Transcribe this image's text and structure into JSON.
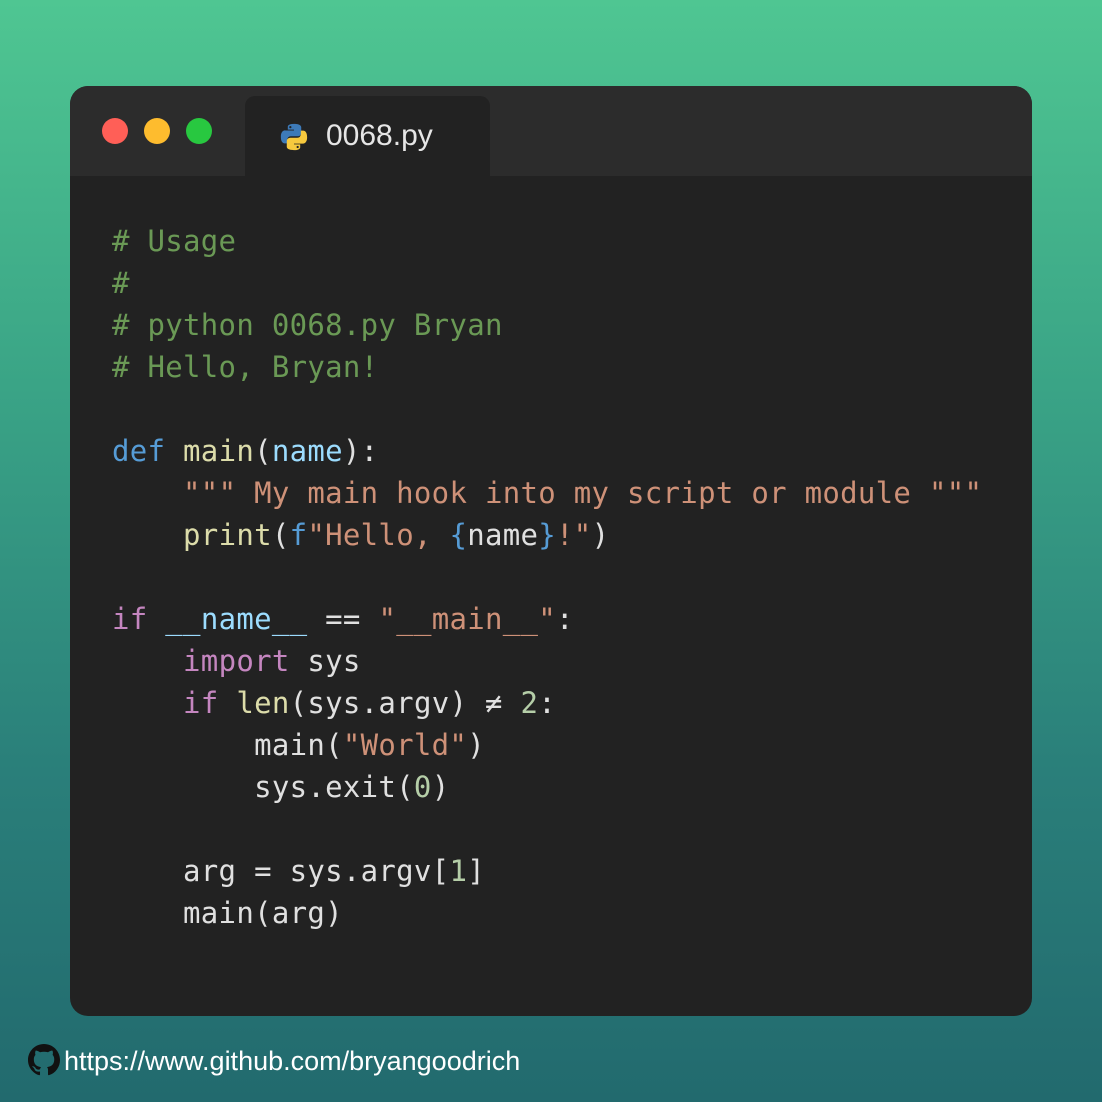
{
  "window": {
    "dots": [
      "close",
      "minimize",
      "maximize"
    ],
    "colors": {
      "close": "#ff5f57",
      "minimize": "#febc2e",
      "maximize": "#28c840"
    }
  },
  "tab": {
    "icon": "python-icon",
    "filename": "0068.py"
  },
  "code": {
    "lines": [
      [
        {
          "t": "# Usage",
          "c": "comment"
        }
      ],
      [
        {
          "t": "#",
          "c": "comment"
        }
      ],
      [
        {
          "t": "# python 0068.py Bryan",
          "c": "comment"
        }
      ],
      [
        {
          "t": "# Hello, Bryan!",
          "c": "comment"
        }
      ],
      [],
      [
        {
          "t": "def",
          "c": "keyword"
        },
        {
          "t": " ",
          "c": "plain"
        },
        {
          "t": "main",
          "c": "func"
        },
        {
          "t": "(",
          "c": "plain"
        },
        {
          "t": "name",
          "c": "param"
        },
        {
          "t": "):",
          "c": "plain"
        }
      ],
      [
        {
          "t": "    ",
          "c": "plain"
        },
        {
          "t": "\"\"\" My main hook into my script or module \"\"\"",
          "c": "string"
        }
      ],
      [
        {
          "t": "    ",
          "c": "plain"
        },
        {
          "t": "print",
          "c": "func"
        },
        {
          "t": "(",
          "c": "plain"
        },
        {
          "t": "f",
          "c": "keyword"
        },
        {
          "t": "\"Hello, ",
          "c": "string"
        },
        {
          "t": "{",
          "c": "brace"
        },
        {
          "t": "name",
          "c": "plain"
        },
        {
          "t": "}",
          "c": "brace"
        },
        {
          "t": "!\"",
          "c": "string"
        },
        {
          "t": ")",
          "c": "plain"
        }
      ],
      [],
      [
        {
          "t": "if",
          "c": "control"
        },
        {
          "t": " ",
          "c": "plain"
        },
        {
          "t": "__name__",
          "c": "param"
        },
        {
          "t": " ",
          "c": "plain"
        },
        {
          "t": "==",
          "c": "plain"
        },
        {
          "t": " ",
          "c": "plain"
        },
        {
          "t": "\"__main__\"",
          "c": "string"
        },
        {
          "t": ":",
          "c": "plain"
        }
      ],
      [
        {
          "t": "    ",
          "c": "plain"
        },
        {
          "t": "import",
          "c": "control"
        },
        {
          "t": " sys",
          "c": "plain"
        }
      ],
      [
        {
          "t": "    ",
          "c": "plain"
        },
        {
          "t": "if",
          "c": "control"
        },
        {
          "t": " ",
          "c": "plain"
        },
        {
          "t": "len",
          "c": "func"
        },
        {
          "t": "(sys.argv) ",
          "c": "plain"
        },
        {
          "t": "≠",
          "c": "plain"
        },
        {
          "t": " ",
          "c": "plain"
        },
        {
          "t": "2",
          "c": "number"
        },
        {
          "t": ":",
          "c": "plain"
        }
      ],
      [
        {
          "t": "        main(",
          "c": "plain"
        },
        {
          "t": "\"World\"",
          "c": "string"
        },
        {
          "t": ")",
          "c": "plain"
        }
      ],
      [
        {
          "t": "        sys.exit(",
          "c": "plain"
        },
        {
          "t": "0",
          "c": "number"
        },
        {
          "t": ")",
          "c": "plain"
        }
      ],
      [],
      [
        {
          "t": "    arg = sys.argv[",
          "c": "plain"
        },
        {
          "t": "1",
          "c": "number"
        },
        {
          "t": "]",
          "c": "plain"
        }
      ],
      [
        {
          "t": "    main(arg)",
          "c": "plain"
        }
      ]
    ]
  },
  "footer": {
    "icon": "github-icon",
    "url": "https://www.github.com/bryangoodrich"
  }
}
